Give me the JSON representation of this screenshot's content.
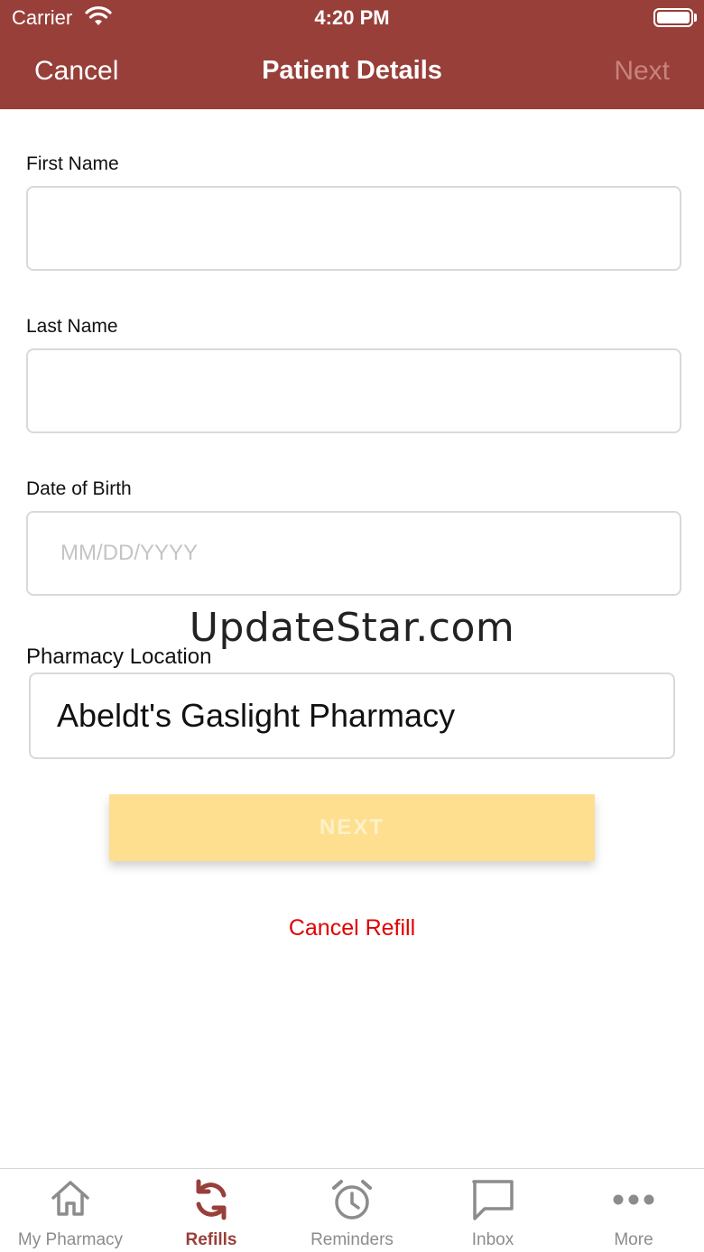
{
  "status_bar": {
    "carrier": "Carrier",
    "time": "4:20 PM"
  },
  "nav": {
    "cancel_label": "Cancel",
    "title": "Patient Details",
    "next_label": "Next"
  },
  "form": {
    "first_name": {
      "label": "First Name",
      "value": "",
      "placeholder": ""
    },
    "last_name": {
      "label": "Last Name",
      "value": "",
      "placeholder": ""
    },
    "dob": {
      "label": "Date of Birth",
      "value": "",
      "placeholder": "MM/DD/YYYY"
    },
    "pharmacy_location": {
      "label": "Pharmacy Location",
      "value": "Abeldt's Gaslight Pharmacy"
    }
  },
  "watermark": "UpdateStar.com",
  "actions": {
    "next_button": "NEXT",
    "cancel_refill": "Cancel Refill"
  },
  "tabs": [
    {
      "label": "My Pharmacy",
      "icon": "home-icon",
      "active": false
    },
    {
      "label": "Refills",
      "icon": "refresh-icon",
      "active": true
    },
    {
      "label": "Reminders",
      "icon": "alarm-clock-icon",
      "active": false
    },
    {
      "label": "Inbox",
      "icon": "message-icon",
      "active": false
    },
    {
      "label": "More",
      "icon": "more-icon",
      "active": false
    }
  ],
  "colors": {
    "brand": "#983f39",
    "next_button": "#fddf8f",
    "cancel_refill": "#e00000",
    "tab_inactive": "#8c8c8c"
  }
}
